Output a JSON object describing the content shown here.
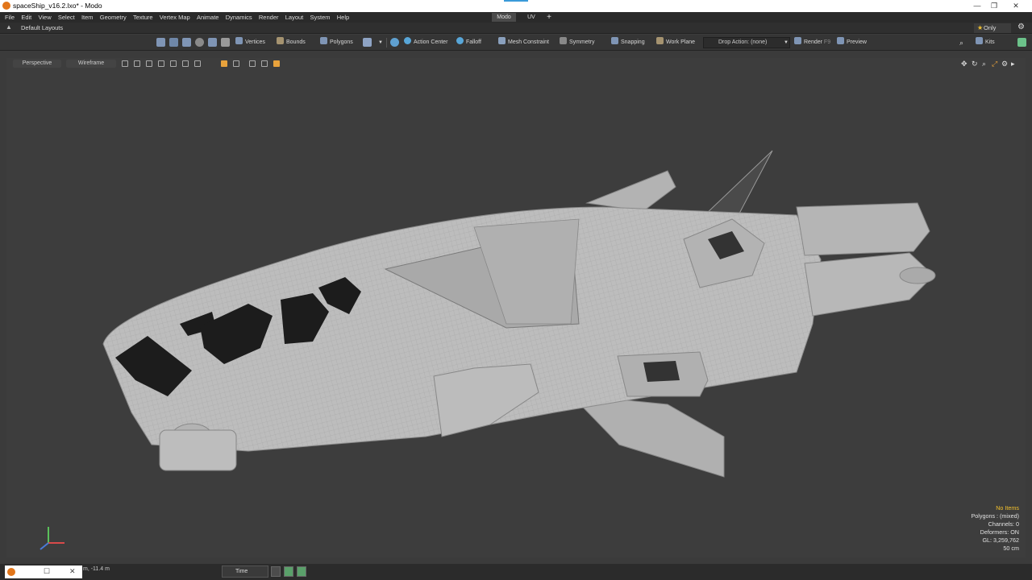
{
  "window": {
    "title": "spaceShip_v16.2.lxo* - Modo",
    "minimize": "—",
    "maximize": "❐",
    "close": "✕"
  },
  "menu": [
    "File",
    "Edit",
    "View",
    "Select",
    "Item",
    "Geometry",
    "Texture",
    "Vertex Map",
    "Animate",
    "Dynamics",
    "Render",
    "Layout",
    "System",
    "Help"
  ],
  "workspace_tabs": {
    "modo": "Modo",
    "uv": "UV",
    "add": "+"
  },
  "layout_bar": {
    "layout": "Default Layouts",
    "only": "Only"
  },
  "toolbar": {
    "vertices": "Vertices",
    "bounds": "Bounds",
    "polygons": "Polygons",
    "action_center": "Action Center",
    "falloff": "Falloff",
    "mesh_constraint": "Mesh Constraint",
    "symmetry": "Symmetry",
    "snapping": "Snapping",
    "work_plane": "Work Plane",
    "drop_action": "Drop Action: (none)",
    "render": "Render",
    "render_key": "F9",
    "preview": "Preview",
    "kits": "Kits"
  },
  "viewport": {
    "view": "Perspective",
    "shading": "Wireframe"
  },
  "hud": {
    "items": "No Items",
    "polygons": "Polygons : (mixed)",
    "channels": "Channels: 0",
    "deformers": "Deformers: ON",
    "gl": "GL: 3,259,762",
    "grid": "50 cm"
  },
  "status": {
    "coord": "m, -11.4 m",
    "time": "Time"
  },
  "colors": {
    "accent": "#e8a23c",
    "highlight": "#f2c02c",
    "viewport_bg": "#3d3d3d",
    "hull": "#b9b9b9"
  }
}
